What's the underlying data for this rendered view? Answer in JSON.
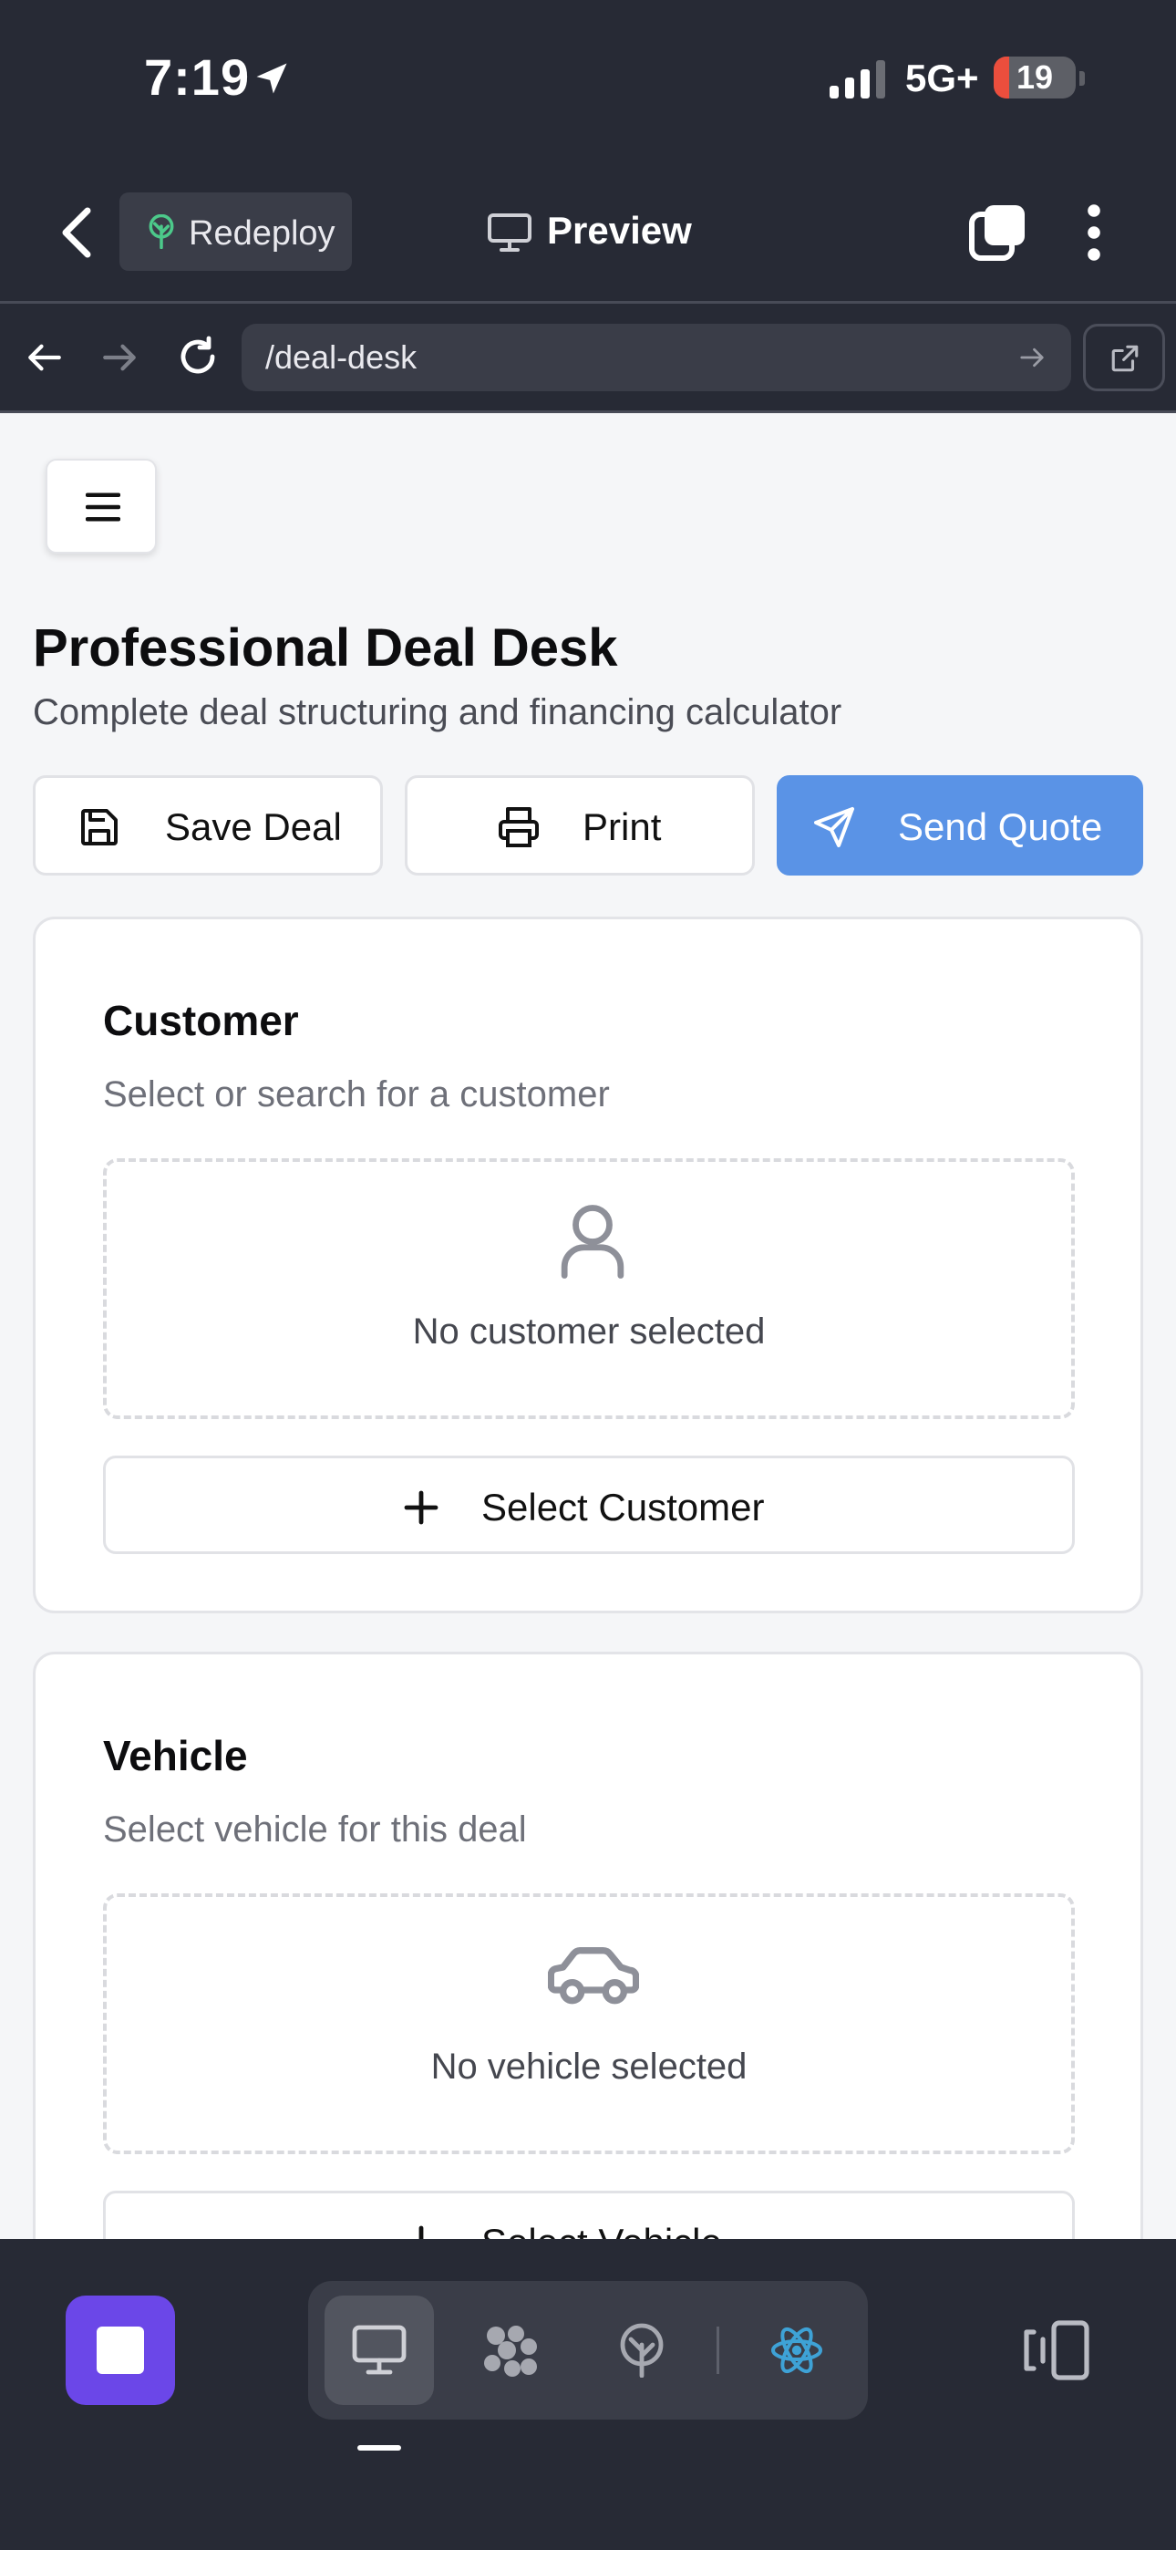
{
  "status_bar": {
    "time": "7:19",
    "network": "5G+",
    "battery_level": "19",
    "battery_fraction": 0.19
  },
  "app_bar": {
    "redeploy_label": "Redeploy",
    "preview_label": "Preview"
  },
  "browser": {
    "url": "/deal-desk"
  },
  "page": {
    "title": "Professional Deal Desk",
    "subtitle": "Complete deal structuring and financing calculator",
    "actions": {
      "save_label": "Save Deal",
      "print_label": "Print",
      "send_label": "Send Quote"
    },
    "customer": {
      "title": "Customer",
      "description": "Select or search for a customer",
      "empty_text": "No customer selected",
      "button_label": "Select Customer"
    },
    "vehicle": {
      "title": "Vehicle",
      "description": "Select vehicle for this deal",
      "empty_text": "No vehicle selected",
      "button_label": "Select Vehicle"
    }
  },
  "colors": {
    "chrome_bg": "#272a35",
    "accent_send": "#5a93e6",
    "stop_button": "#6b47e8",
    "battery_low": "#eb4e3d",
    "react_icon": "#3ea2d6"
  },
  "icons": {
    "status": [
      "location-arrow-icon",
      "signal-bars-icon",
      "battery-icon"
    ],
    "app_bar": [
      "chevron-left-icon",
      "deploy-tree-icon",
      "monitor-icon",
      "tabs-icon",
      "more-vertical-icon"
    ],
    "browser": [
      "arrow-left-icon",
      "arrow-right-icon",
      "reload-icon",
      "external-link-icon"
    ],
    "page": [
      "menu-icon",
      "save-icon",
      "printer-icon",
      "send-icon",
      "user-icon",
      "plus-icon",
      "car-icon"
    ],
    "toolbar": [
      "stop-icon",
      "monitor-icon",
      "cluster-icon",
      "deploy-icon",
      "react-icon",
      "panel-toggle-icon"
    ]
  }
}
